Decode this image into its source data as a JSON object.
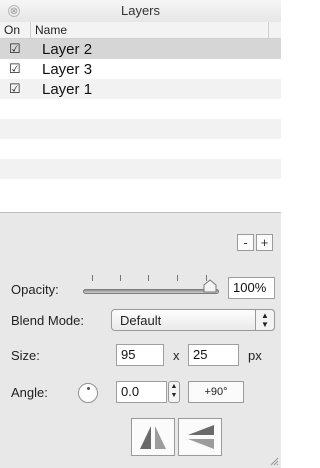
{
  "window": {
    "title": "Layers",
    "close_icon": "close-icon"
  },
  "table": {
    "headers": {
      "on": "On",
      "name": "Name"
    },
    "rows": [
      {
        "checked": true,
        "name": "Layer 2",
        "selected": true
      },
      {
        "checked": true,
        "name": "Layer 3",
        "selected": false
      },
      {
        "checked": true,
        "name": "Layer 1",
        "selected": false
      }
    ],
    "check_glyph": "☑"
  },
  "controls": {
    "minus_label": "-",
    "plus_label": "+",
    "opacity": {
      "label": "Opacity:",
      "value": "100%",
      "level": 1.0
    },
    "blend_mode": {
      "label": "Blend Mode:",
      "value": "Default"
    },
    "size": {
      "label": "Size:",
      "width": "95",
      "x": "x",
      "height": "25",
      "unit": "px"
    },
    "angle": {
      "label": "Angle:",
      "value": "0.0",
      "rotate_label": "+90°"
    }
  },
  "colors": {
    "selected_row": "#d6d6d6",
    "panel": "#e8e8e8"
  }
}
